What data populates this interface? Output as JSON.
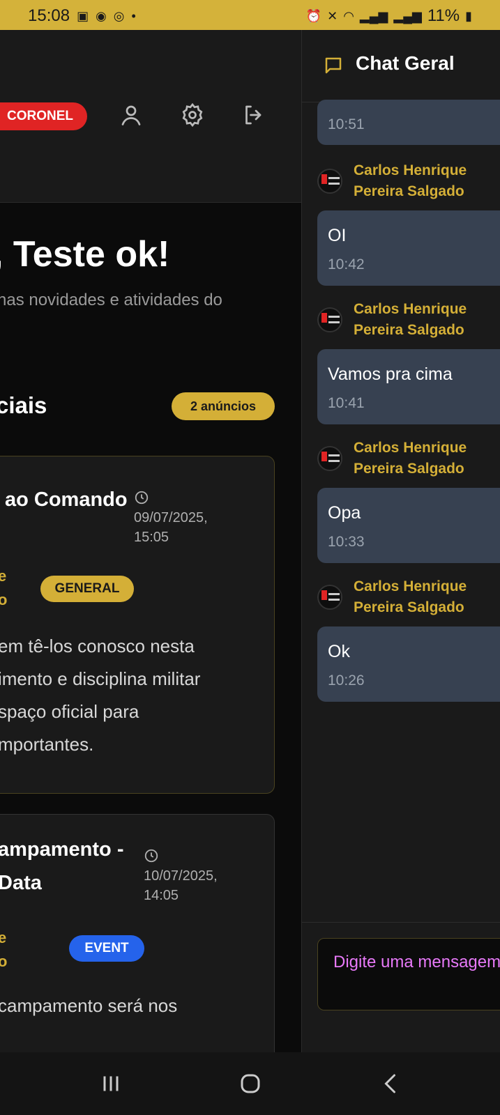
{
  "status_bar": {
    "time": "15:08",
    "battery": "11%",
    "left_icons": [
      "gallery-icon",
      "chrome-icon",
      "whatsapp-icon",
      "dot-icon"
    ],
    "right_icons": [
      "alarm-icon",
      "mute-icon",
      "wifi-icon",
      "signal-icon",
      "signal-icon",
      "battery-icon"
    ]
  },
  "header": {
    "role_badge": "CORONEL",
    "icons": [
      "user-icon",
      "settings-icon",
      "logout-icon"
    ]
  },
  "welcome": {
    "title": ", Teste ok!",
    "subtitle": "nas novidades e atividades do"
  },
  "announcements": {
    "section_title": "ciais",
    "count_label": "2 anúncios",
    "items": [
      {
        "title": "ao Comando",
        "title_line2": "",
        "date_line1": "09/07/2025,",
        "date_line2": "15:05",
        "author_line1": "e",
        "author_line2": "o",
        "tag": "GENERAL",
        "body": [
          "em tê-los conosco nesta",
          "imento e disciplina militar",
          "spaço oficial para",
          "mportantes."
        ]
      },
      {
        "title": "ampamento -",
        "title_line2": "Data",
        "date_line1": "10/07/2025,",
        "date_line2": "14:05",
        "author_line1": "e",
        "author_line2": "o",
        "tag": "EVENT",
        "body": [
          "campamento será nos"
        ]
      }
    ]
  },
  "chat": {
    "title": "Chat Geral",
    "messages": [
      {
        "sender_line1": "",
        "sender_line2": "",
        "text": "",
        "time": "10:51"
      },
      {
        "sender_line1": "Carlos Henrique",
        "sender_line2": "Pereira Salgado",
        "text": "OI",
        "time": "10:42"
      },
      {
        "sender_line1": "Carlos Henrique",
        "sender_line2": "Pereira Salgado",
        "text": "Vamos pra cima",
        "time": "10:41"
      },
      {
        "sender_line1": "Carlos Henrique",
        "sender_line2": "Pereira Salgado",
        "text": "Opa",
        "time": "10:33"
      },
      {
        "sender_line1": "Carlos Henrique",
        "sender_line2": "Pereira Salgado",
        "text": "Ok",
        "time": "10:26"
      }
    ],
    "input_placeholder": "Digite uma mensagem"
  },
  "colors": {
    "accent_gold": "#d4af37",
    "status_bar": "#d4b23a",
    "badge_red": "#e02424",
    "event_blue": "#2563eb",
    "bubble": "#374151",
    "placeholder_pink": "#e879f9"
  }
}
